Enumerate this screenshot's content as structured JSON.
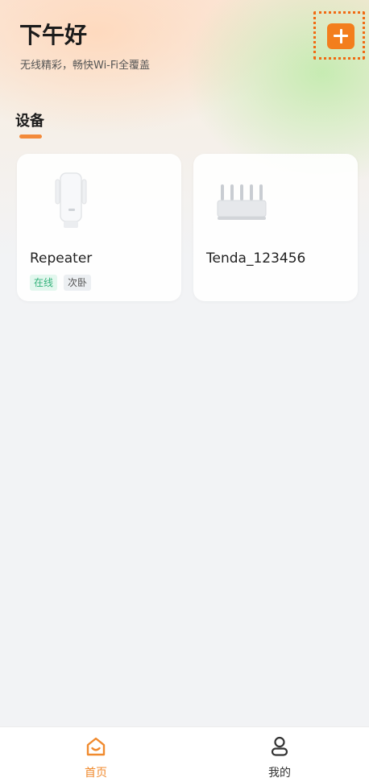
{
  "header": {
    "greeting": "下午好",
    "subtitle": "无线精彩，畅快Wi-Fi全覆盖",
    "add_icon": "plus-icon"
  },
  "devices_section": {
    "title": "设备",
    "devices": [
      {
        "name": "Repeater",
        "status": "在线",
        "room": "次卧",
        "image": "repeater-device"
      },
      {
        "name": "Tenda_123456",
        "image": "router-device"
      }
    ]
  },
  "tabbar": {
    "tabs": [
      {
        "label": "首页",
        "icon": "home-icon",
        "active": true
      },
      {
        "label": "我的",
        "icon": "user-icon",
        "active": false
      }
    ]
  },
  "colors": {
    "accent": "#f37e1d",
    "online_text": "#33b27a",
    "background": "#f2f3f5"
  }
}
